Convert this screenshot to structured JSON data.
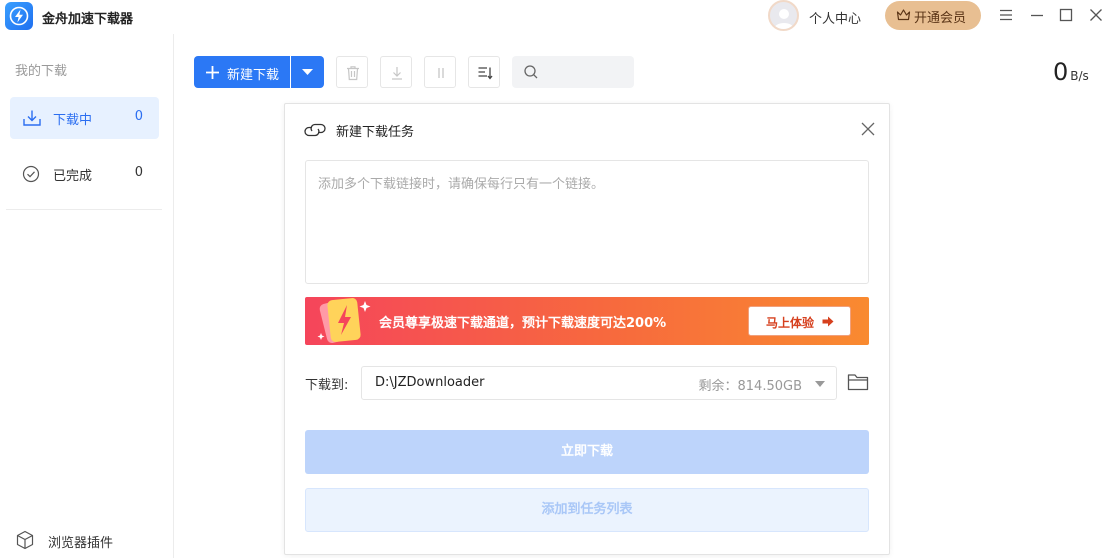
{
  "app": {
    "title": "金舟加速下载器"
  },
  "header": {
    "user_center": "个人中心",
    "vip_button": "开通会员"
  },
  "sidebar": {
    "heading": "我的下载",
    "items": [
      {
        "label": "下载中",
        "count": "0",
        "icon": "download-icon",
        "active": true
      },
      {
        "label": "已完成",
        "count": "0",
        "icon": "check-circle-icon",
        "active": false
      }
    ],
    "plugin_label": "浏览器插件"
  },
  "toolbar": {
    "new_download_label": "新建下载",
    "search_placeholder": ""
  },
  "speed": {
    "value": "0",
    "unit": "B/s"
  },
  "dialog": {
    "title": "新建下载任务",
    "url_placeholder": "添加多个下载链接时，请确保每行只有一个链接。",
    "banner_text": "会员尊享极速下载通道，预计下载速度可达200%",
    "banner_button": "马上体验",
    "path_label": "下载到:",
    "path_value": "D:\\JZDownloader",
    "free_label": "剩余：",
    "free_value": "814.50GB",
    "download_now": "立即下载",
    "add_to_list": "添加到任务列表"
  },
  "colors": {
    "accent": "#2b78f5",
    "vip": "#e8bf92",
    "banner_start": "#f5455b",
    "banner_end": "#f98a30"
  }
}
